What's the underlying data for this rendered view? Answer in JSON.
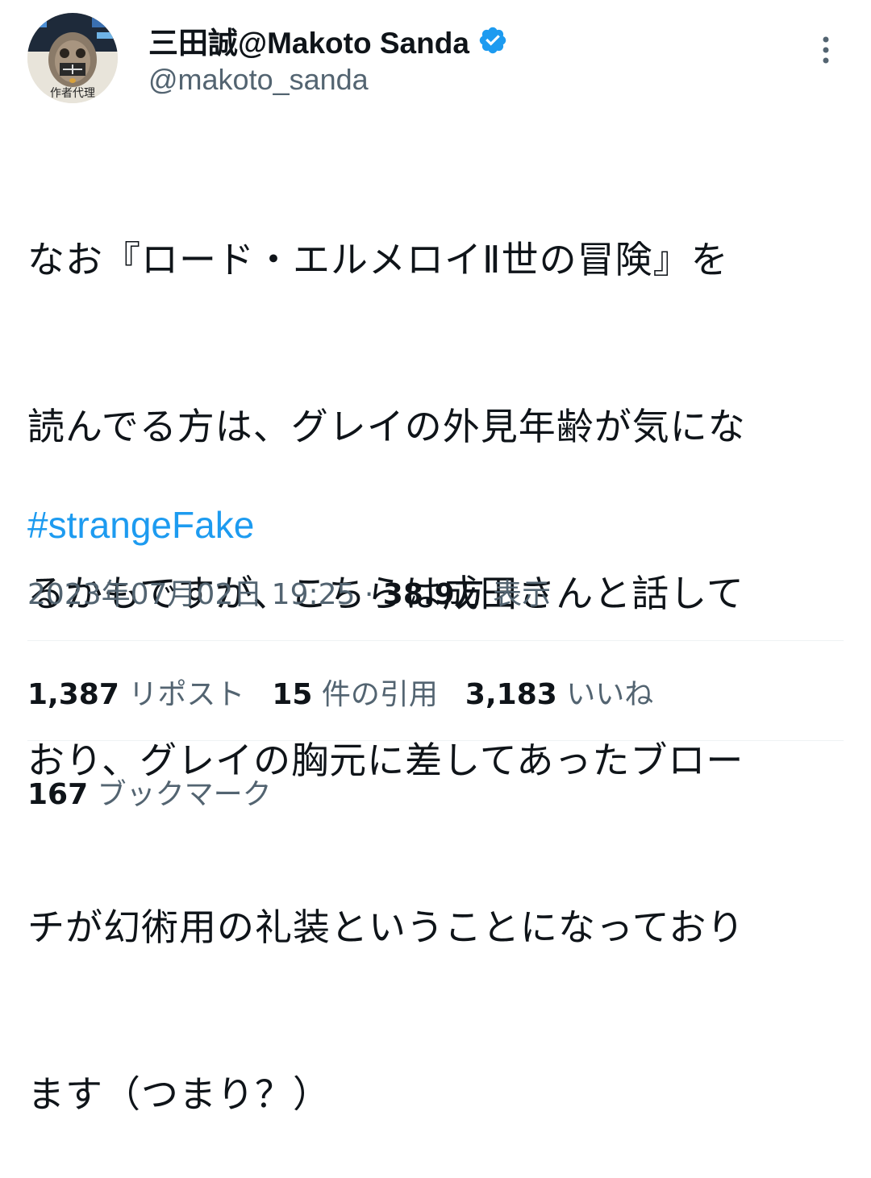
{
  "author": {
    "display_name": "三田誠@Makoto Sanda",
    "handle": "@makoto_sanda",
    "avatar_text": "作者代理",
    "verified": true
  },
  "tweet": {
    "lines": [
      "なお『ロード・エルメロイⅡ世の冒険』を",
      "読んでる方は、グレイの外見年齢が気にな",
      "るかもですが、こちらは成田さんと話して",
      "おり、グレイの胸元に差してあったブロー",
      "チが幻術用の礼装ということになっており",
      "ます（つまり？）"
    ],
    "hashtag": "#strangeFake"
  },
  "meta": {
    "timestamp": "2023年07月02日 19:25",
    "separator": "·",
    "views_count": "38.9万",
    "views_label": "表示"
  },
  "stats": {
    "reposts_count": "1,387",
    "reposts_label": "リポスト",
    "quotes_count": "15",
    "quotes_label": "件の引用",
    "likes_count": "3,183",
    "likes_label": "いいね",
    "bookmarks_count": "167",
    "bookmarks_label": "ブックマーク"
  },
  "colors": {
    "link": "#1d9bf0",
    "verified": "#1d9bf0",
    "secondary_text": "#536471",
    "primary_text": "#0f1419",
    "divider": "#eff3f4"
  },
  "icons": {
    "verified": "verified-badge-icon",
    "more": "more-options-icon"
  }
}
